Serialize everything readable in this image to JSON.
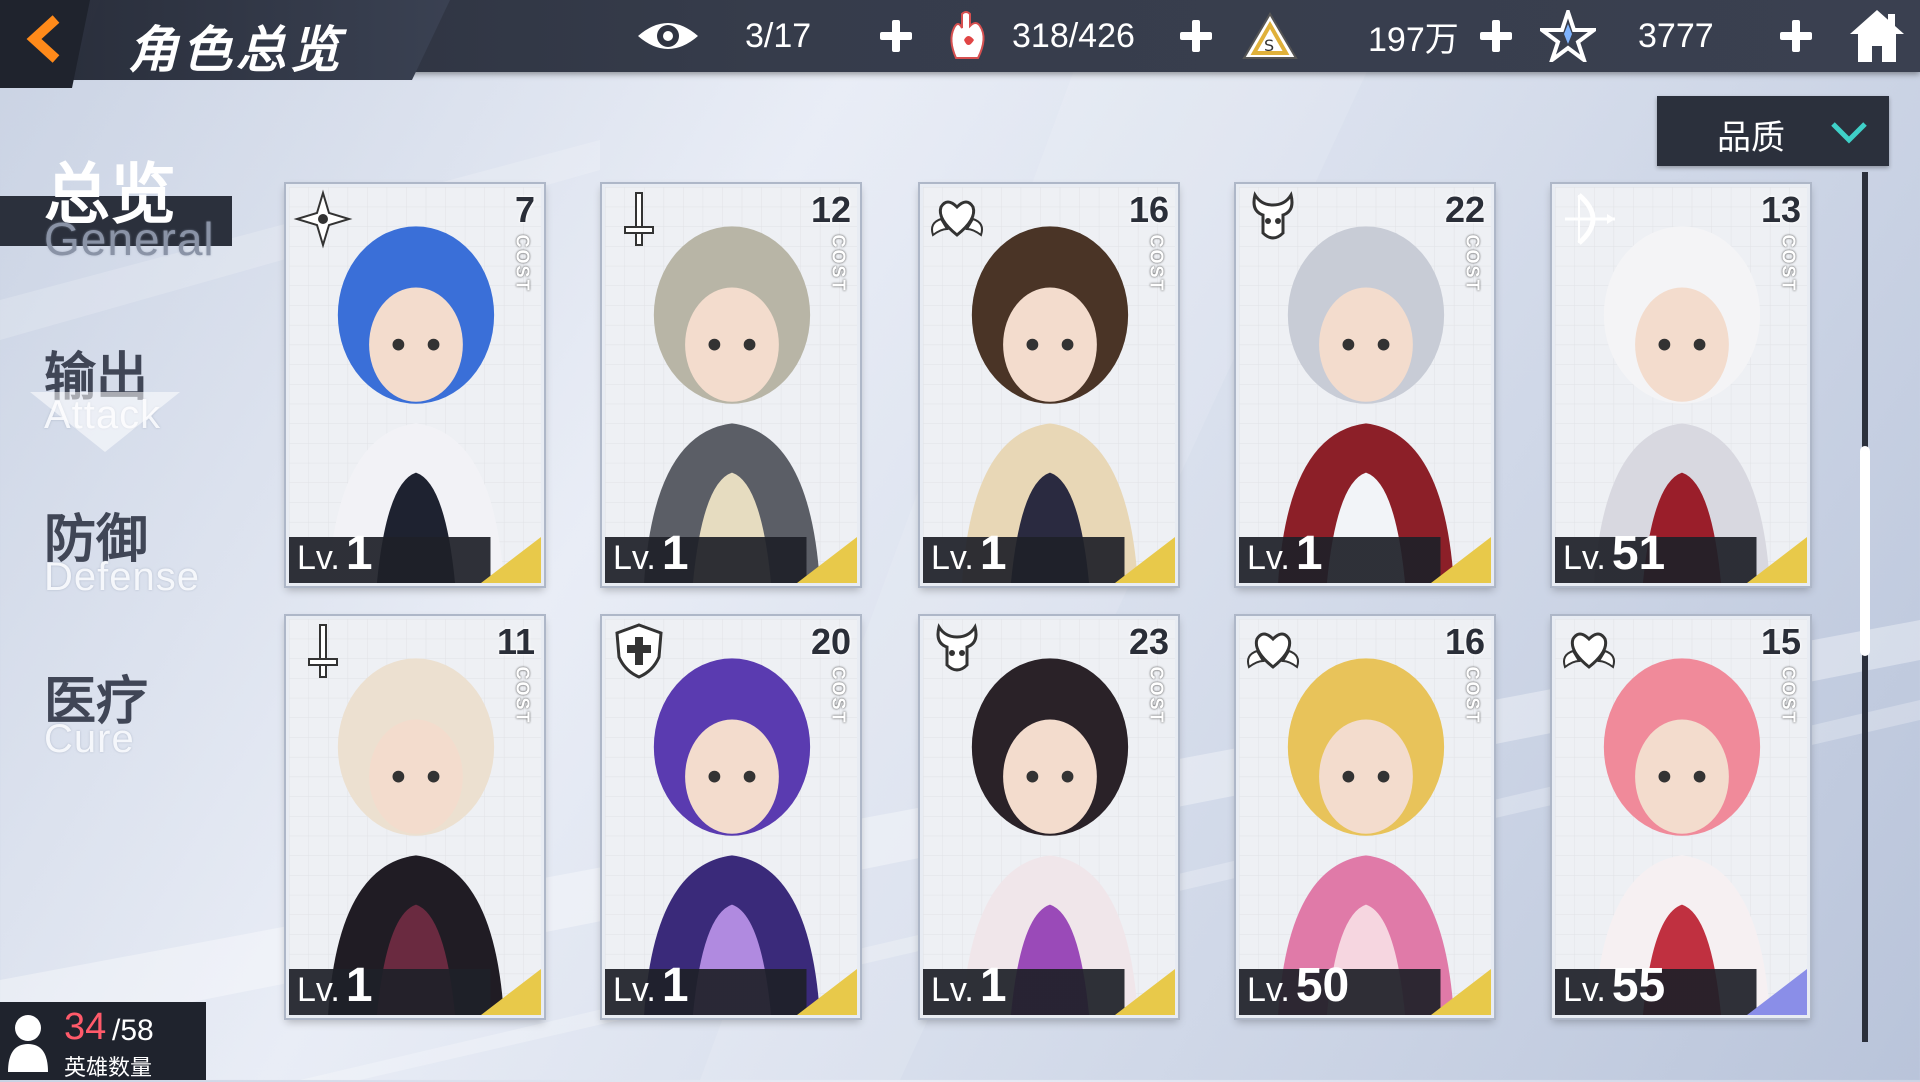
{
  "header": {
    "title": "角色总览",
    "resources": [
      {
        "icon": "eye-icon",
        "value": "3/17"
      },
      {
        "icon": "stamina-hand-icon",
        "value": "318/426"
      },
      {
        "icon": "gold-pyramid-icon",
        "value": "197万"
      },
      {
        "icon": "crystal-star-icon",
        "value": "3777"
      }
    ]
  },
  "filter": {
    "label": "品质"
  },
  "sidebar": {
    "items": [
      {
        "zh": "总览",
        "en": "General",
        "active": true
      },
      {
        "zh": "输出",
        "en": "Attack"
      },
      {
        "zh": "防御",
        "en": "Defense"
      },
      {
        "zh": "医疗",
        "en": "Cure"
      }
    ]
  },
  "cards": [
    {
      "cost": "7",
      "cost_label": "COST",
      "lv_prefix": "Lv.",
      "level": "1",
      "class_icon": "shuriken-icon",
      "rarity_color": "#e8c94a"
    },
    {
      "cost": "12",
      "cost_label": "COST",
      "lv_prefix": "Lv.",
      "level": "1",
      "class_icon": "sword-icon",
      "rarity_color": "#e8c94a"
    },
    {
      "cost": "16",
      "cost_label": "COST",
      "lv_prefix": "Lv.",
      "level": "1",
      "class_icon": "heart-wings-icon",
      "rarity_color": "#e8c94a"
    },
    {
      "cost": "22",
      "cost_label": "COST",
      "lv_prefix": "Lv.",
      "level": "1",
      "class_icon": "demon-skull-icon",
      "rarity_color": "#e8c94a"
    },
    {
      "cost": "13",
      "cost_label": "COST",
      "lv_prefix": "Lv.",
      "level": "51",
      "class_icon": "bow-icon",
      "rarity_color": "#e8c94a"
    },
    {
      "cost": "11",
      "cost_label": "COST",
      "lv_prefix": "Lv.",
      "level": "1",
      "class_icon": "sword-icon",
      "rarity_color": "#e8c94a"
    },
    {
      "cost": "20",
      "cost_label": "COST",
      "lv_prefix": "Lv.",
      "level": "1",
      "class_icon": "shield-icon",
      "rarity_color": "#e8c94a"
    },
    {
      "cost": "23",
      "cost_label": "COST",
      "lv_prefix": "Lv.",
      "level": "1",
      "class_icon": "demon-skull-icon",
      "rarity_color": "#e8c94a"
    },
    {
      "cost": "16",
      "cost_label": "COST",
      "lv_prefix": "Lv.",
      "level": "50",
      "class_icon": "heart-wings-icon",
      "rarity_color": "#e8c94a"
    },
    {
      "cost": "15",
      "cost_label": "COST",
      "lv_prefix": "Lv.",
      "level": "55",
      "class_icon": "heart-wings-icon",
      "rarity_color": "#8a8ee8"
    }
  ],
  "hero_count": {
    "current": "34",
    "max": "/58",
    "label": "英雄数量"
  },
  "colors": {
    "accent_orange": "#ff8a1a",
    "panel_dark": "#2b303c",
    "hero_count_red": "#ff5a6a"
  }
}
